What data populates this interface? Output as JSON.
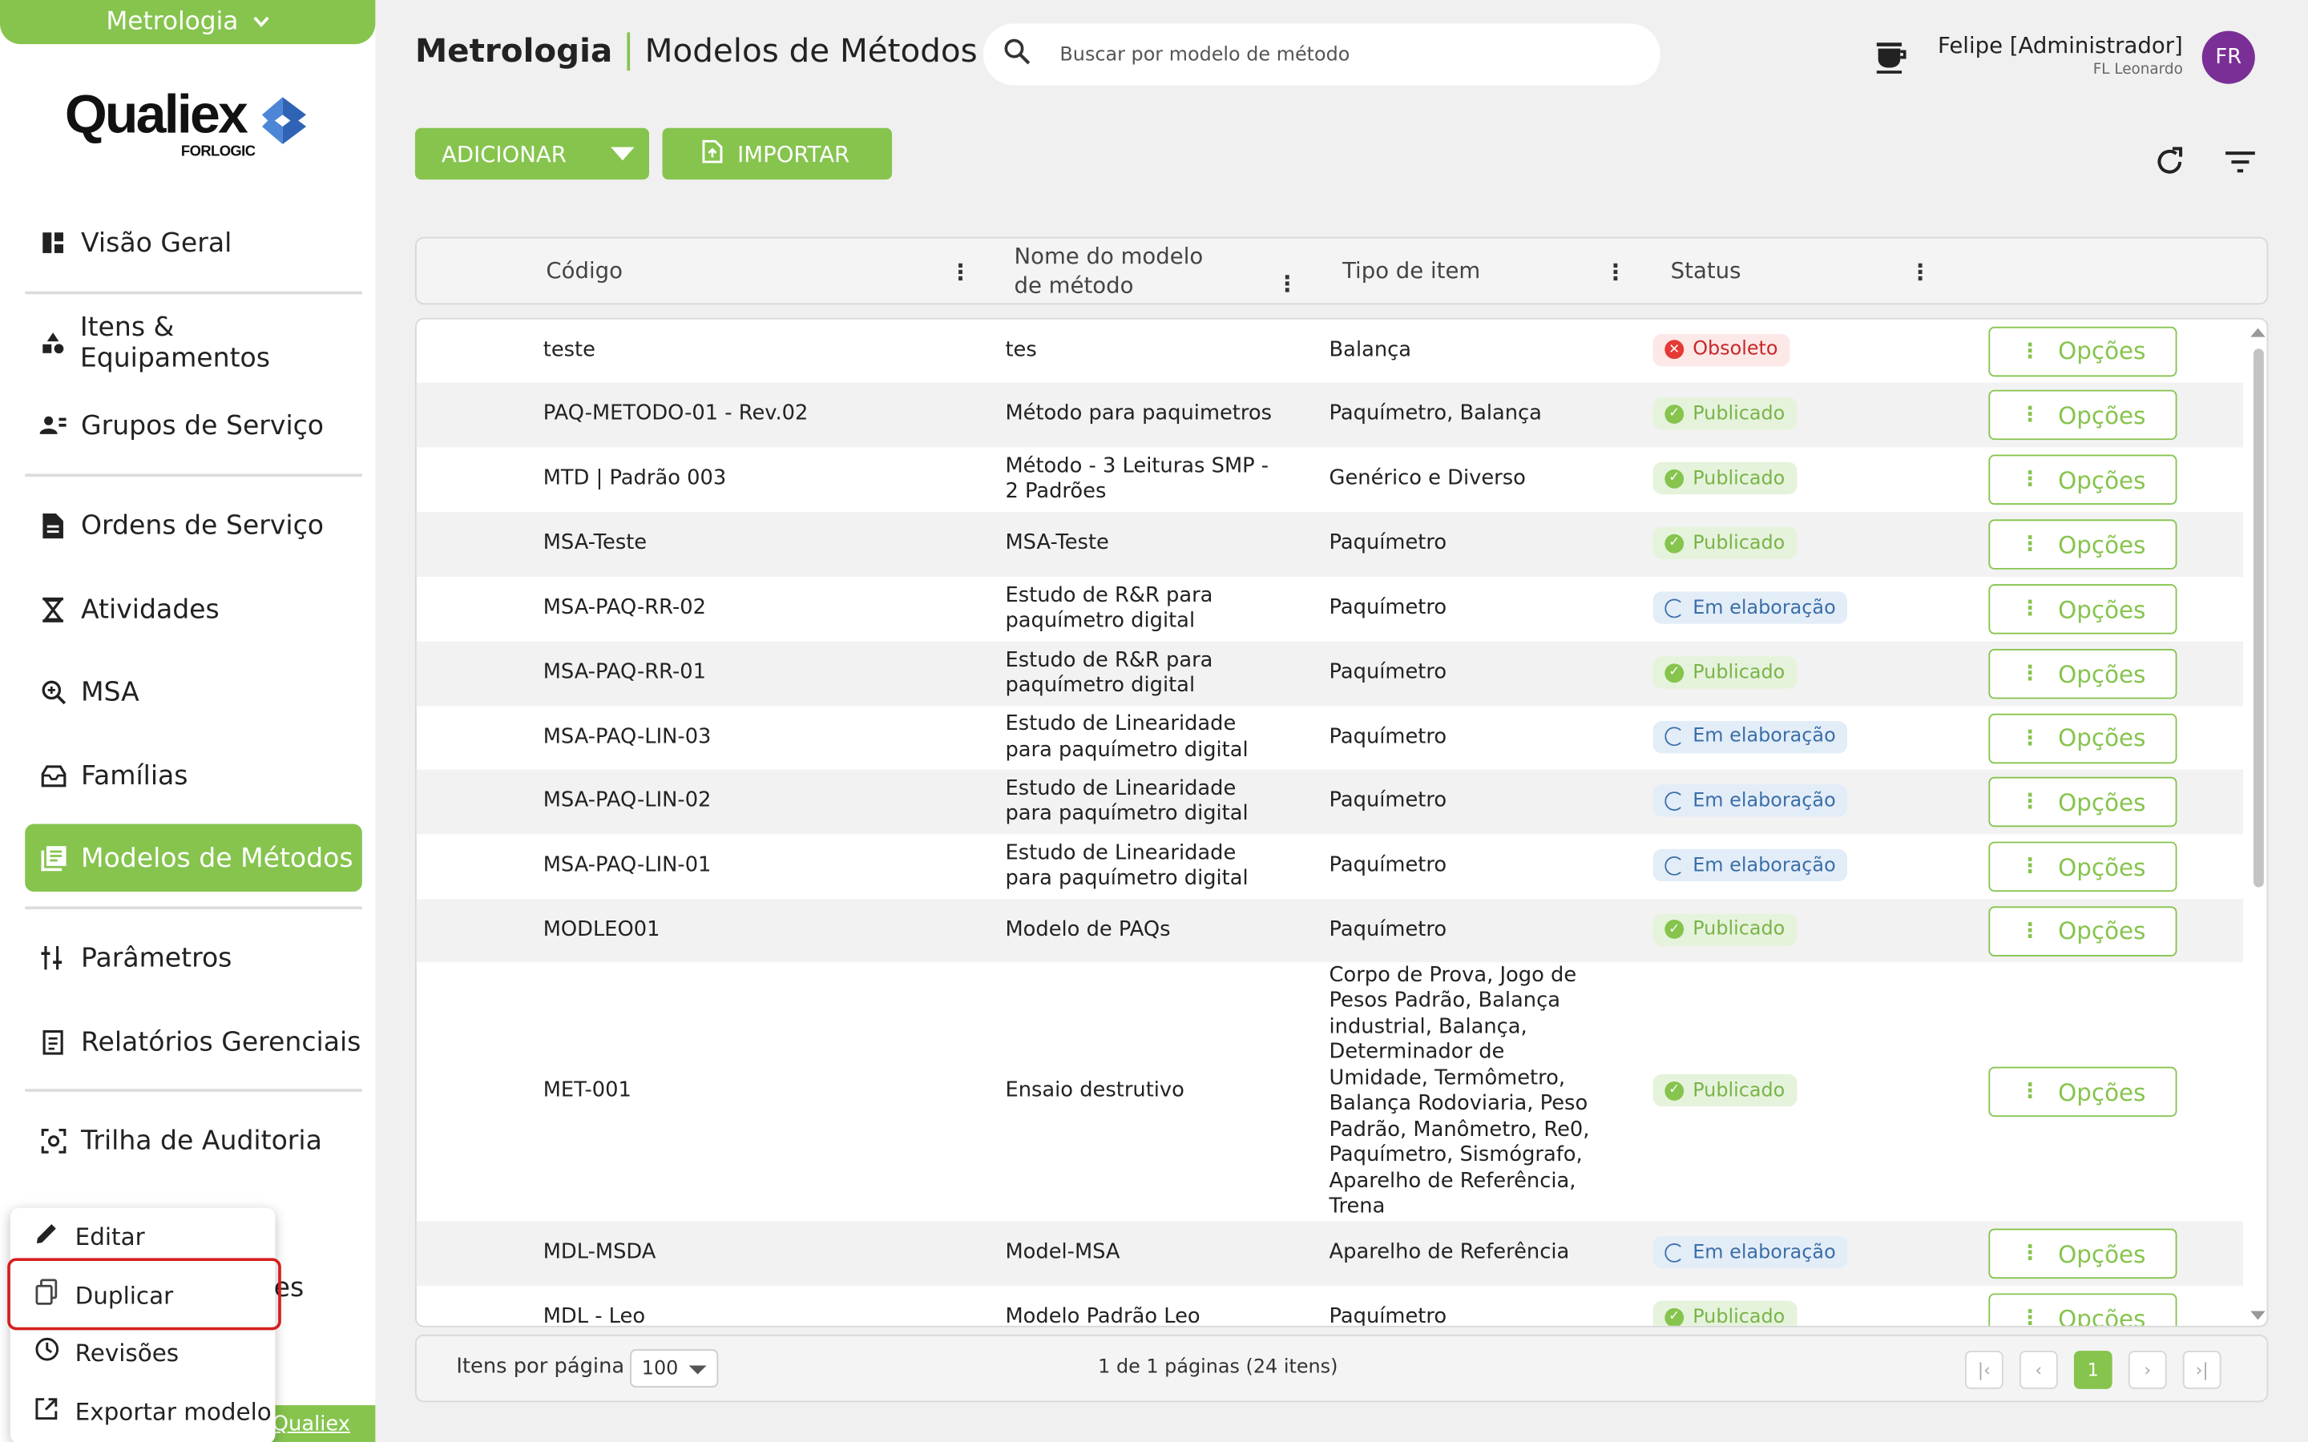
{
  "module": {
    "label": "Metrologia"
  },
  "brand": {
    "word": "Qualiex",
    "sub": "FORLOGIC",
    "accent": "#86c44e",
    "mark_color": "#2f63b5"
  },
  "sidebar": {
    "items": [
      {
        "label": "Visão Geral",
        "icon": "dashboard-icon"
      },
      {
        "label": "Itens & Equipamentos",
        "icon": "shapes-icon"
      },
      {
        "label": "Grupos de Serviço",
        "icon": "group-icon"
      },
      {
        "label": "Ordens de Serviço",
        "icon": "document-icon"
      },
      {
        "label": "Atividades",
        "icon": "hourglass-icon"
      },
      {
        "label": "MSA",
        "icon": "zoom-icon"
      },
      {
        "label": "Famílias",
        "icon": "inbox-icon"
      },
      {
        "label": "Modelos de Métodos",
        "icon": "library-icon"
      },
      {
        "label": "Parâmetros",
        "icon": "tune-icon"
      },
      {
        "label": "Relatórios Gerenciais",
        "icon": "report-icon"
      },
      {
        "label": "Trilha de Auditoria",
        "icon": "audit-icon"
      }
    ],
    "hidden_text": "es",
    "footer_link": "Qualiex"
  },
  "context_menu": {
    "items": [
      {
        "label": "Editar",
        "icon": "pencil-icon"
      },
      {
        "label": "Duplicar",
        "icon": "duplicate-icon"
      },
      {
        "label": "Revisões",
        "icon": "history-icon"
      },
      {
        "label": "Exportar modelo",
        "icon": "export-icon"
      }
    ]
  },
  "header": {
    "title_module": "Metrologia",
    "title_page": "Modelos de Métodos",
    "search_placeholder": "Buscar por modelo de método",
    "user_name": "Felipe [Administrador]",
    "user_org": "FL Leonardo",
    "avatar_initials": "FR"
  },
  "toolbar": {
    "add_label": "ADICIONAR",
    "import_label": "IMPORTAR"
  },
  "table": {
    "columns": [
      "Código",
      "Nome do modelo de método",
      "Tipo de item",
      "Status"
    ],
    "options_label": "Opções",
    "rows": [
      {
        "codigo": "teste",
        "nome": "tes",
        "tipo": "Balança",
        "status": "Obsoleto"
      },
      {
        "codigo": "PAQ-METODO-01 - Rev.02",
        "nome": "Método para paquimetros",
        "tipo": "Paquímetro, Balança",
        "status": "Publicado"
      },
      {
        "codigo": "MTD | Padrão 003",
        "nome": "Método - 3 Leituras SMP - 2 Padrões",
        "tipo": "Genérico e Diverso",
        "status": "Publicado"
      },
      {
        "codigo": "MSA-Teste",
        "nome": "MSA-Teste",
        "tipo": "Paquímetro",
        "status": "Publicado"
      },
      {
        "codigo": "MSA-PAQ-RR-02",
        "nome": "Estudo de R&R para paquímetro digital",
        "tipo": "Paquímetro",
        "status": "Em elaboração"
      },
      {
        "codigo": "MSA-PAQ-RR-01",
        "nome": "Estudo de R&R para paquímetro digital",
        "tipo": "Paquímetro",
        "status": "Publicado"
      },
      {
        "codigo": "MSA-PAQ-LIN-03",
        "nome": "Estudo de Linearidade para paquímetro digital",
        "tipo": "Paquímetro",
        "status": "Em elaboração"
      },
      {
        "codigo": "MSA-PAQ-LIN-02",
        "nome": "Estudo de Linearidade para paquímetro digital",
        "tipo": "Paquímetro",
        "status": "Em elaboração"
      },
      {
        "codigo": "MSA-PAQ-LIN-01",
        "nome": "Estudo de Linearidade para paquímetro digital",
        "tipo": "Paquímetro",
        "status": "Em elaboração"
      },
      {
        "codigo": "MODLEO01",
        "nome": "Modelo de PAQs",
        "tipo": "Paquímetro",
        "status": "Publicado"
      },
      {
        "codigo": "MET-001",
        "nome": "Ensaio destrutivo",
        "tipo": "Corpo de Prova, Jogo de Pesos Padrão, Balança industrial, Balança, Determinador de Umidade, Termômetro, Balança Rodoviaria, Peso Padrão, Manômetro, Re0, Paquímetro, Sismógrafo, Aparelho de Referência, Trena",
        "status": "Publicado"
      },
      {
        "codigo": "MDL-MSDA",
        "nome": "Model-MSA",
        "tipo": "Aparelho de Referência",
        "status": "Em elaboração"
      },
      {
        "codigo": "MDL - Leo",
        "nome": "Modelo Padrão Leo",
        "tipo": "Paquímetro",
        "status": "Publicado"
      }
    ]
  },
  "pagination": {
    "per_page_label": "Itens por página",
    "per_page_value": "100",
    "info": "1 de 1 páginas (24 itens)",
    "current_page": "1"
  }
}
